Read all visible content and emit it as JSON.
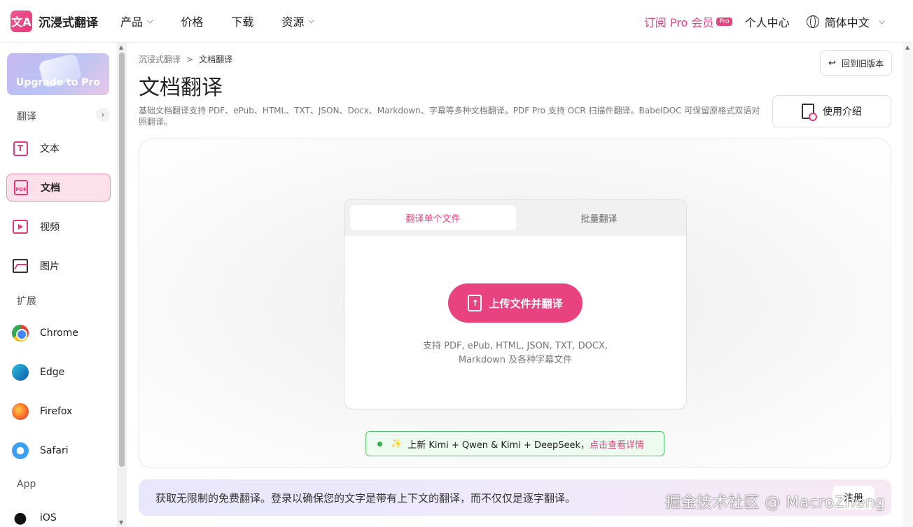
{
  "header": {
    "logo_text": "沉浸式翻译",
    "logo_mark": "文A",
    "nav": [
      {
        "label": "产品",
        "has_dropdown": true
      },
      {
        "label": "价格",
        "has_dropdown": false
      },
      {
        "label": "下载",
        "has_dropdown": false
      },
      {
        "label": "资源",
        "has_dropdown": true
      }
    ],
    "subscribe_label": "订阅 Pro 会员",
    "pro_badge": "Pro",
    "user_center": "个人中心",
    "language": "简体中文"
  },
  "sidebar": {
    "upgrade_label": "Upgrade to Pro",
    "section_translate": "翻译",
    "section_extension": "扩展",
    "section_app": "App",
    "translate_items": [
      {
        "label": "文本",
        "icon": "text-icon"
      },
      {
        "label": "文档",
        "icon": "pdf-document-icon",
        "active": true
      },
      {
        "label": "视频",
        "icon": "video-icon"
      },
      {
        "label": "图片",
        "icon": "image-icon"
      }
    ],
    "extension_items": [
      {
        "label": "Chrome",
        "icon": "chrome-icon"
      },
      {
        "label": "Edge",
        "icon": "edge-icon"
      },
      {
        "label": "Firefox",
        "icon": "firefox-icon"
      },
      {
        "label": "Safari",
        "icon": "safari-icon"
      }
    ],
    "app_items": [
      {
        "label": "iOS",
        "icon": "apple-icon"
      }
    ]
  },
  "main": {
    "breadcrumb": [
      "沉浸式翻译",
      "文档翻译"
    ],
    "breadcrumb_sep": ">",
    "title": "文档翻译",
    "description": "基础文档翻译支持 PDF、ePub、HTML、TXT、JSON、Docx、Markdown、字幕等多种文档翻译。PDF Pro 支持 OCR 扫描件翻译。BabelDOC 可保留原格式双语对照翻译。",
    "old_version_label": "回到旧版本",
    "guide_label": "使用介绍",
    "tabs": [
      "翻译单个文件",
      "批量翻译"
    ],
    "upload_button": "上传文件并翻译",
    "support_line1": "支持 PDF, ePub, HTML, JSON, TXT, DOCX,",
    "support_line2": "Markdown 及各种字幕文件",
    "news_text": "上新 Kimi + Qwen & Kimi + DeepSeek，",
    "news_link": "点击查看详情",
    "login_banner_text": "获取无限制的免费翻译。登录以确保您的文字是带有上下文的翻译，而不仅仅是逐字翻译。",
    "login_button": "注册"
  },
  "watermark": "掘金技术社区 @ MacroZheng",
  "colors": {
    "accent": "#e8437f",
    "active_bg": "#fde1ea",
    "news_green": "#2fb14d"
  }
}
